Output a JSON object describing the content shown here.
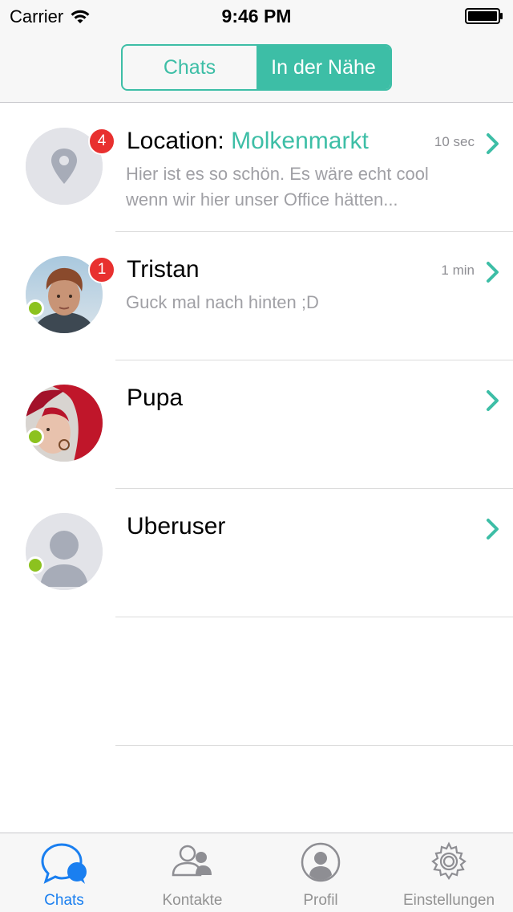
{
  "status_bar": {
    "carrier": "Carrier",
    "time": "9:46 PM"
  },
  "segments": [
    {
      "label": "Chats",
      "active": false
    },
    {
      "label": "In der Nähe",
      "active": true
    }
  ],
  "colors": {
    "accent": "#3dbea6",
    "badge": "#e8302f",
    "online": "#8cc21f",
    "tab_active": "#1a7ff0"
  },
  "chats": [
    {
      "title": "Location: ",
      "title_accent": "Molkenmarkt",
      "preview": "Hier ist es so schön. Es wäre echt cool wenn wir hier unser Office hätten...",
      "time": "10 sec",
      "badge": "4",
      "avatar_icon": "location-pin-icon",
      "online": false
    },
    {
      "title": "Tristan",
      "preview": "Guck mal nach hinten ;D",
      "time": "1 min",
      "badge": "1",
      "avatar_icon": "photo-avatar",
      "online": true
    },
    {
      "title": "Pupa",
      "preview": "",
      "time": "",
      "avatar_icon": "photo-avatar",
      "online": true
    },
    {
      "title": "Uberuser",
      "preview": "",
      "time": "",
      "avatar_icon": "default-person-icon",
      "online": true
    }
  ],
  "tabbar": [
    {
      "label": "Chats",
      "icon": "chat-bubbles-icon",
      "active": true
    },
    {
      "label": "Kontakte",
      "icon": "contacts-icon",
      "active": false
    },
    {
      "label": "Profil",
      "icon": "profile-icon",
      "active": false
    },
    {
      "label": "Einstellungen",
      "icon": "gear-icon",
      "active": false
    }
  ]
}
